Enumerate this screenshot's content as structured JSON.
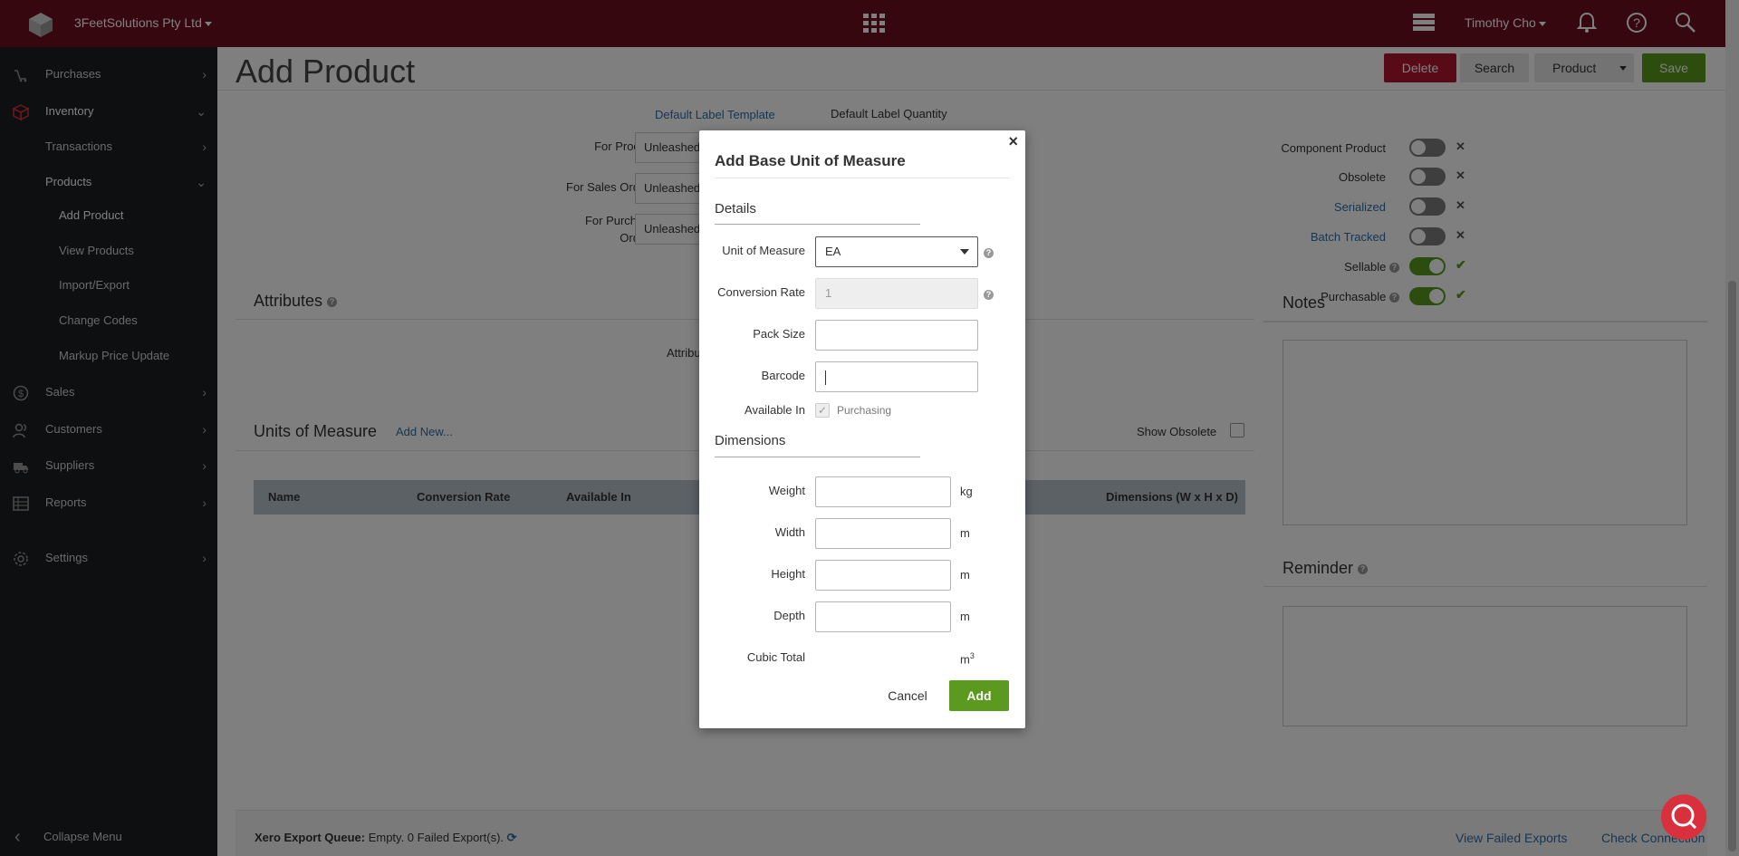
{
  "topbar": {
    "company": "3FeetSolutions Pty Ltd",
    "user": "Timothy Cho",
    "icons": [
      "logo-icon",
      "apps-grid-icon",
      "stack-icon",
      "bell-icon",
      "help-icon",
      "search-icon"
    ]
  },
  "sidebar": {
    "items": [
      {
        "label": "Purchases"
      },
      {
        "label": "Inventory"
      },
      {
        "label": "Transactions"
      },
      {
        "label": "Products"
      },
      {
        "label": "Add Product"
      },
      {
        "label": "View Products"
      },
      {
        "label": "Import/Export"
      },
      {
        "label": "Change Codes"
      },
      {
        "label": "Markup Price Update"
      },
      {
        "label": "Sales"
      },
      {
        "label": "Customers"
      },
      {
        "label": "Suppliers"
      },
      {
        "label": "Reports"
      },
      {
        "label": "Settings"
      }
    ],
    "collapse": "Collapse Menu"
  },
  "page": {
    "title": "Add Product",
    "actions": {
      "delete": "Delete",
      "search": "Search",
      "product": "Product",
      "save": "Save"
    }
  },
  "labels": {
    "default_label_template": "Default Label Template",
    "default_label_quantity": "Default Label Quantity",
    "for_product": "For Product",
    "for_sales_orders": "For Sales Orders",
    "for_purchase_orders_1": "For Purchase",
    "for_purchase_orders_2": "Orders",
    "unleashed": "Unleashed"
  },
  "attributes": {
    "title": "Attributes",
    "partial": "Attribu"
  },
  "uom": {
    "title": "Units of Measure",
    "add_new": "Add New...",
    "show_obsolete": "Show Obsolete",
    "columns": [
      "Name",
      "Conversion Rate",
      "Available In",
      "Dimensions (W x H x D)"
    ]
  },
  "flags": [
    {
      "label": "Component Product",
      "on": false,
      "link": false
    },
    {
      "label": "Obsolete",
      "on": false,
      "link": false
    },
    {
      "label": "Serialized",
      "on": false,
      "link": true
    },
    {
      "label": "Batch Tracked",
      "on": false,
      "link": true
    },
    {
      "label": "Sellable",
      "on": true,
      "link": false
    },
    {
      "label": "Purchasable",
      "on": true,
      "link": false
    }
  ],
  "notes": {
    "title": "Notes"
  },
  "reminder": {
    "title": "Reminder"
  },
  "footer": {
    "queue_label": "Xero Export Queue:",
    "queue_status": "Empty. 0 Failed Export(s).",
    "view_failed": "View Failed Exports",
    "check_connection": "Check Connection"
  },
  "modal": {
    "title": "Add Base Unit of Measure",
    "details": "Details",
    "unit_of_measure_label": "Unit of Measure",
    "unit_of_measure_value": "EA",
    "conversion_rate_label": "Conversion Rate",
    "conversion_rate_value": "1",
    "pack_size_label": "Pack Size",
    "barcode_label": "Barcode",
    "available_in_label": "Available In",
    "available_in_option": "Purchasing",
    "dimensions": "Dimensions",
    "weight_label": "Weight",
    "width_label": "Width",
    "height_label": "Height",
    "depth_label": "Depth",
    "cubic_total_label": "Cubic Total",
    "unit_kg": "kg",
    "unit_m": "m",
    "unit_m3": "m",
    "unit_m3_sup": "3",
    "cancel": "Cancel",
    "add": "Add"
  },
  "colors": {
    "topbar": "#6e0f1e",
    "sidebar": "#1d1f22",
    "accent_green": "#5b9a1e",
    "delete_red": "#b0172d",
    "link_blue": "#2e6ea6"
  }
}
